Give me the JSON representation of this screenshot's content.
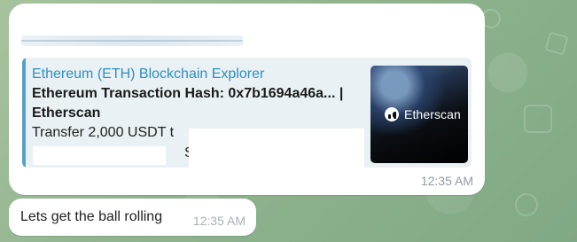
{
  "app": {
    "name": "Telegram"
  },
  "colors": {
    "chat_background": "#8fb38d",
    "bubble_background": "#ffffff",
    "link_accent": "#54a0c8",
    "site_name_color": "#2d8fc0",
    "timestamp_color": "#8f9ba4"
  },
  "messages": [
    {
      "timestamp": "12:35 AM",
      "preview": {
        "site_name": "Ethereum (ETH) Blockchain Explorer",
        "title": "Ethereum Transaction Hash: 0x7b1694a46a... | Etherscan",
        "description_visible": "Transfer 2,000 USDT t",
        "description_fragment": "S",
        "thumbnail": {
          "brand": "Etherscan",
          "icon": "etherscan-logo-icon"
        }
      }
    },
    {
      "text": "Lets get the ball rolling",
      "timestamp": "12:35 AM"
    }
  ]
}
